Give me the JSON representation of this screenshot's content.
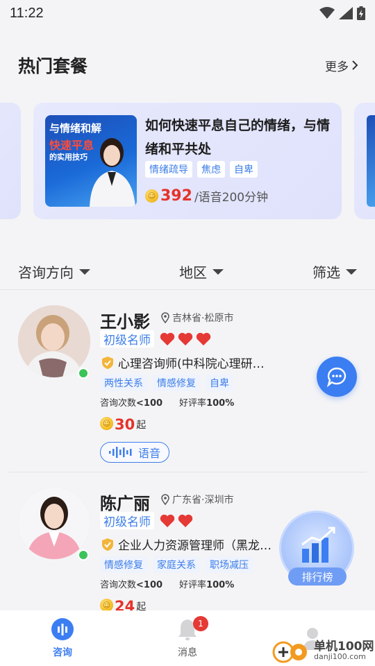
{
  "status_bar": {
    "time": "11:22"
  },
  "hot": {
    "title": "热门套餐",
    "more": "更多"
  },
  "package": {
    "thumb_line1": "与情绪和解",
    "thumb_line2": "快速平息",
    "thumb_line3": "的实用技巧",
    "title": "如何快速平息自己的情绪，与情绪和平共处",
    "tags": [
      "情绪疏导",
      "焦虑",
      "自卑"
    ],
    "price": "392",
    "unit": "/语音200分钟"
  },
  "filters": [
    "咨询方向",
    "地区",
    "筛选"
  ],
  "counselors": [
    {
      "name": "王小影",
      "location": "吉林省·松原市",
      "level": "初级名师",
      "hearts": 3,
      "title": "心理咨询师(中科院心理研…",
      "tags": [
        "两性关系",
        "情感修复",
        "自卑"
      ],
      "count_label": "咨询次数",
      "count_value": "<100",
      "rate_label": "好评率",
      "rate_value": "100%",
      "price": "30",
      "price_suffix": "起",
      "voice_label": "语音"
    },
    {
      "name": "陈广丽",
      "location": "广东省·深圳市",
      "level": "初级名师",
      "hearts": 2,
      "title": "企业人力资源管理师（黑龙…",
      "tags": [
        "情感修复",
        "家庭关系",
        "职场减压"
      ],
      "count_label": "咨询次数",
      "count_value": "<100",
      "rate_label": "好评率",
      "rate_value": "100%",
      "price": "24",
      "price_suffix": "起"
    }
  ],
  "rank": {
    "label": "排行榜"
  },
  "nav": {
    "consult": "咨询",
    "messages": "消息",
    "messages_badge": "1"
  },
  "watermark": {
    "name": "单机100网",
    "url": "danji100.com"
  },
  "colors": {
    "accent": "#3b7ef2",
    "price": "#e5332a",
    "online": "#3cc35a",
    "heart": "#e53935"
  }
}
